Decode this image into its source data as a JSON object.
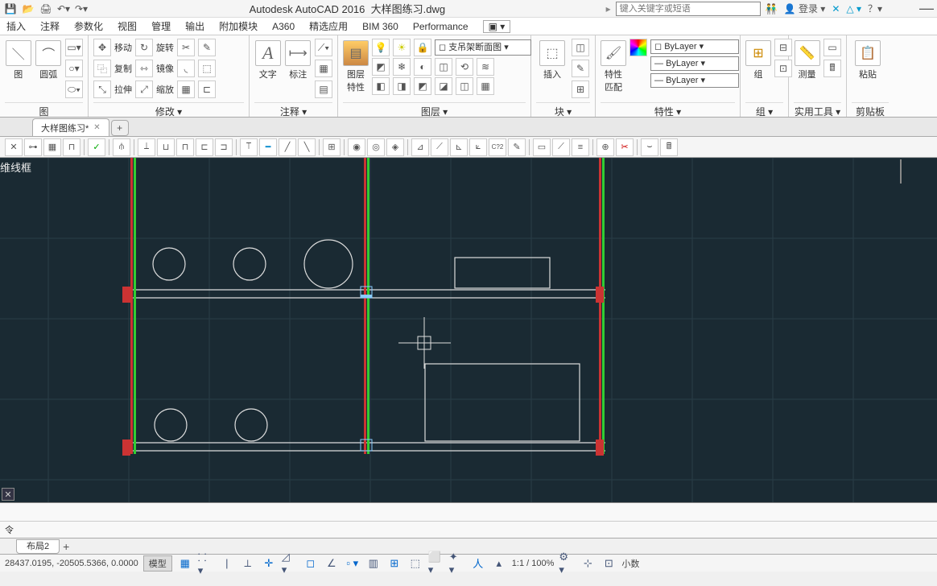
{
  "title": {
    "app": "Autodesk AutoCAD 2016",
    "file": "大样图练习.dwg"
  },
  "search_placeholder": "键入关键字或短语",
  "login": "登录",
  "menu": [
    "插入",
    "注释",
    "参数化",
    "视图",
    "管理",
    "输出",
    "附加模块",
    "A360",
    "精选应用",
    "BIM 360",
    "Performance"
  ],
  "ribbon": {
    "draw": {
      "title": "图",
      "b1": "图",
      "b2": "圆弧"
    },
    "modify": {
      "title": "修改 ▾",
      "r1": [
        "移动",
        "旋转"
      ],
      "r2": [
        "复制",
        "镜像"
      ],
      "r3": [
        "拉伸",
        "缩放"
      ]
    },
    "annot": {
      "title": "注释 ▾",
      "b1": "文字",
      "b2": "标注"
    },
    "layer": {
      "title": "图层 ▾",
      "big": "图层\n特性",
      "sel": "支吊架断面图"
    },
    "block": {
      "title": "块 ▾",
      "big": "插入"
    },
    "props": {
      "title": "特性 ▾",
      "big": "特性\n匹配",
      "p1": "ByLayer",
      "p2": "ByLayer",
      "p3": "ByLayer"
    },
    "group": {
      "title": "组 ▾",
      "big": "组"
    },
    "util": {
      "title": "实用工具 ▾",
      "big": "测量"
    },
    "clip": {
      "title": "剪贴板",
      "big": "粘贴"
    }
  },
  "filetab": {
    "name": "大样图练习*"
  },
  "viewstyle": "维线框",
  "cmd_prompt": "令",
  "layout_tab": "布局2",
  "coords": "28437.0195, -20505.5366, 0.0000",
  "modelbtn": "模型",
  "zoom": "1:1 / 100%",
  "decimal": "小数"
}
